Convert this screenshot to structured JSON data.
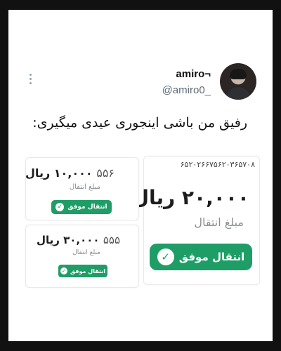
{
  "profile": {
    "display_name": "amiro¬",
    "handle": "@amiro0_"
  },
  "tweet": {
    "text": "رفیق من باشی اینجوری عیدی میگیری:"
  },
  "receipts": [
    {
      "amount": "۲۰,۰۰۰ ریال",
      "label": "مبلغ انتقال",
      "tracking_number": "۶۵۲۰۲۶۶۷۵۶۲۰۳۶۵۷۰۸",
      "status": "انتقال موفق",
      "status_icon": "check-icon"
    },
    {
      "amount": "۱۰,۰۰۰ ریال",
      "amount_prefix": "۵۵۶",
      "label": "مبلغ انتقال",
      "status": "انتقال موفق",
      "status_icon": "check-icon"
    },
    {
      "amount": "۳۰,۰۰۰ ریال",
      "amount_prefix": "۵۵۵",
      "label": "مبلغ انتقال",
      "status": "انتقال موفق",
      "status_icon": "check-icon"
    }
  ],
  "colors": {
    "success_green": "#1f9d67",
    "muted_text": "#8b8f95",
    "border": "#e7e9eb"
  }
}
